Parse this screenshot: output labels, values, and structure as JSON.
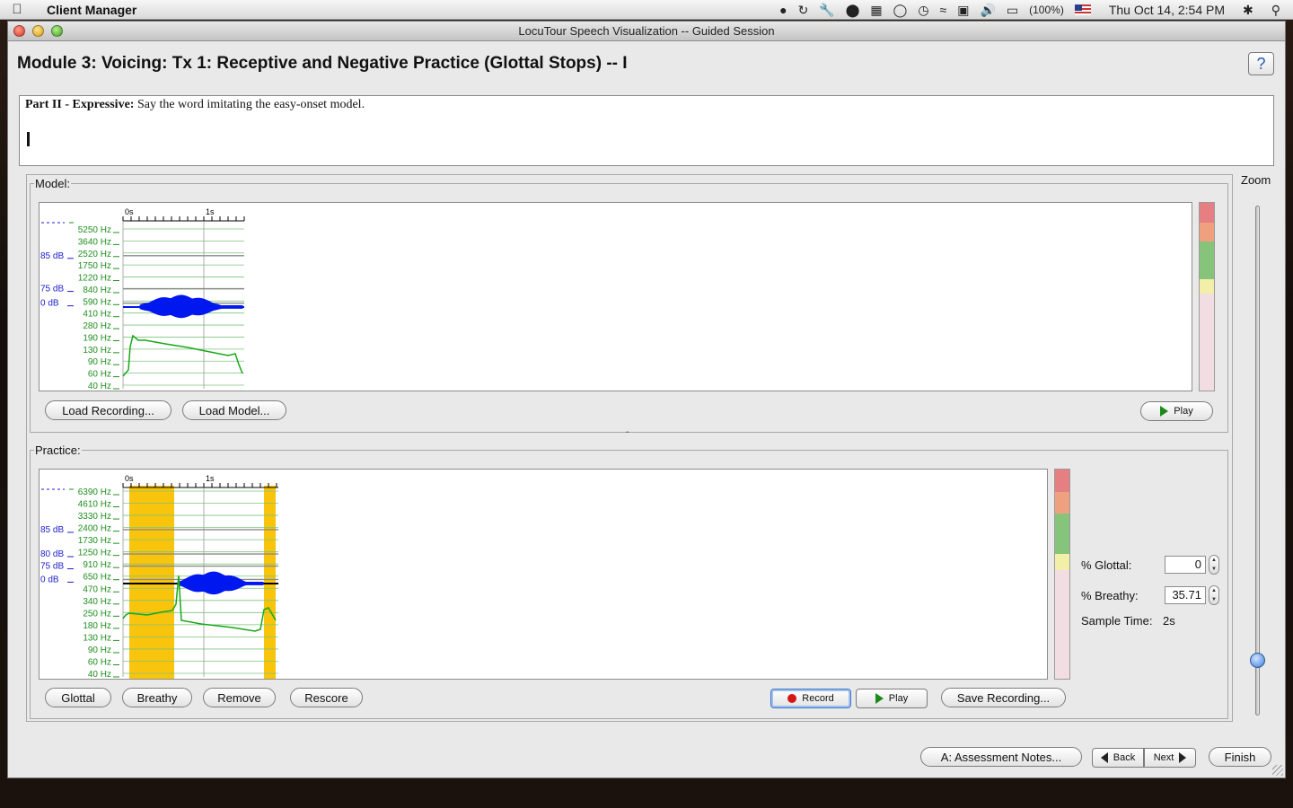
{
  "menubar": {
    "apple_icon": "apple-icon",
    "app_name": "Client Manager",
    "battery": "(100%)",
    "datetime": "Thu Oct 14,  2:54 PM"
  },
  "window": {
    "title": "LocuTour Speech Visualization -- Guided Session",
    "heading": "Module 3: Voicing: Tx 1: Receptive and Negative Practice (Glottal Stops) -- I",
    "help_label": "?"
  },
  "instructions": {
    "bold_prefix": "Part II - Expressive:",
    "text": " Say the word imitating the easy-onset model."
  },
  "model": {
    "legend": "Model:",
    "time_labels": [
      "0s",
      "1s"
    ],
    "db_labels": [
      "85 dB",
      "75 dB",
      "0 dB"
    ],
    "freq_labels": [
      "5250 Hz",
      "3640 Hz",
      "2520 Hz",
      "1750 Hz",
      "1220 Hz",
      "840 Hz",
      "590 Hz",
      "410 Hz",
      "280 Hz",
      "190 Hz",
      "130 Hz",
      "90 Hz",
      "60 Hz",
      "40 Hz"
    ],
    "load_recording_label": "Load Recording...",
    "load_model_label": "Load Model...",
    "play_label": "Play"
  },
  "practice": {
    "legend": "Practice:",
    "time_labels": [
      "0s",
      "1s"
    ],
    "db_labels": [
      "85 dB",
      "80 dB",
      "75 dB",
      "0 dB"
    ],
    "freq_labels": [
      "6390 Hz",
      "4610 Hz",
      "3330 Hz",
      "2400 Hz",
      "1730 Hz",
      "1250 Hz",
      "910 Hz",
      "650 Hz",
      "470 Hz",
      "340 Hz",
      "250 Hz",
      "180 Hz",
      "130 Hz",
      "90 Hz",
      "60 Hz",
      "40 Hz"
    ],
    "glottal_btn": "Glottal",
    "breathy_btn": "Breathy",
    "remove_btn": "Remove",
    "rescore_btn": "Rescore",
    "record_btn": "Record",
    "play_btn": "Play",
    "save_btn": "Save Recording...",
    "pct_glottal_label": "% Glottal:",
    "pct_glottal_value": "0",
    "pct_breathy_label": "% Breathy:",
    "pct_breathy_value": "35.71",
    "sample_time_label": "Sample Time:",
    "sample_time_value": "2s"
  },
  "zoom_label": "Zoom",
  "footer": {
    "assessment_btn": "A: Assessment Notes...",
    "back_btn": "Back",
    "next_btn": "Next",
    "finish_btn": "Finish"
  },
  "colors": {
    "meter": [
      "#e57f82",
      "#eea07f",
      "#86c47c",
      "#f2f0a8",
      "#f1dde2"
    ],
    "glottal_highlight": "#f9c40c",
    "waveform": "#0018f0",
    "pitch": "#18a818",
    "freq_text": "#1f8f1f",
    "db_text": "#1c1ccc"
  }
}
